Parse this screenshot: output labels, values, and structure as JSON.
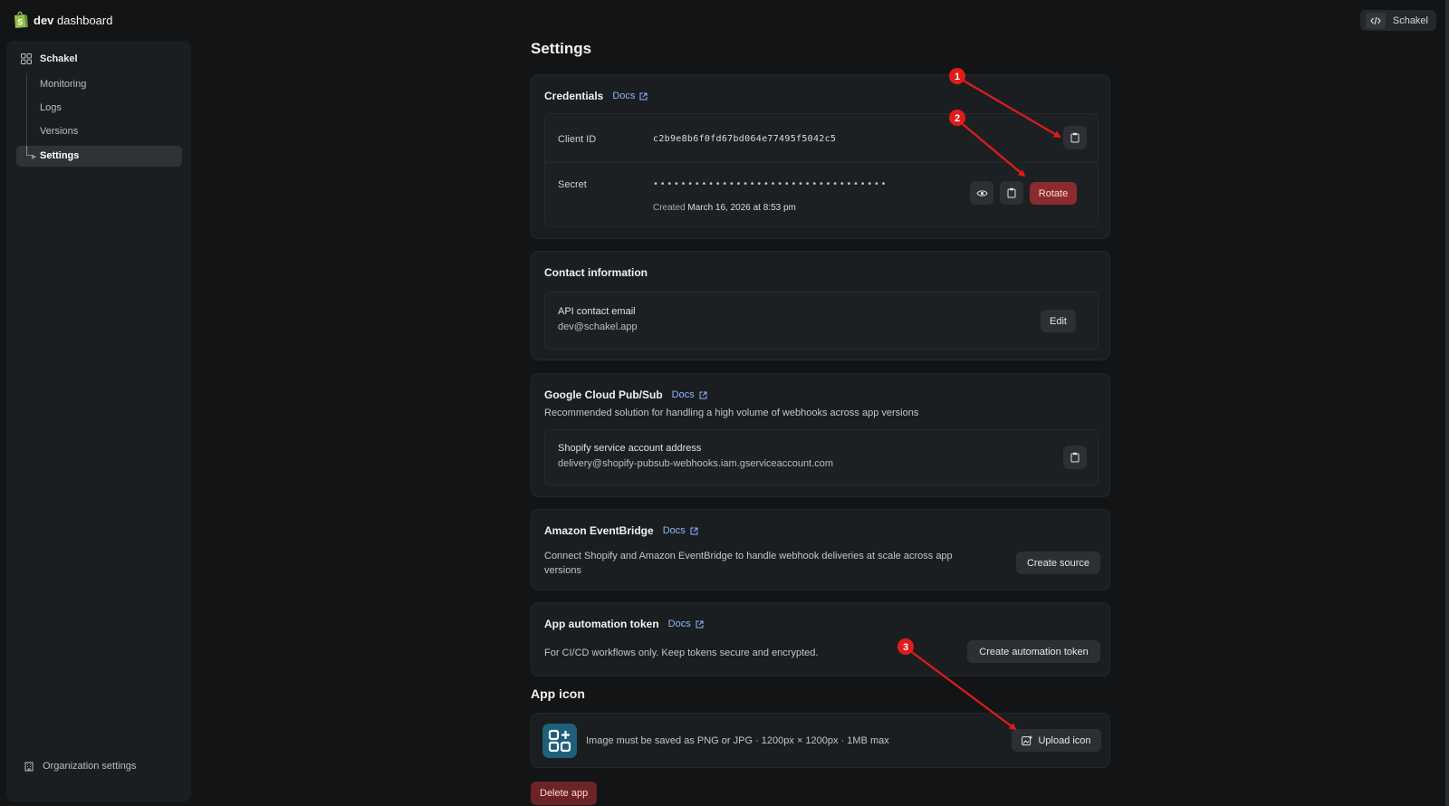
{
  "topbar": {
    "brand_bold": "dev",
    "brand_rest": " dashboard",
    "user_label": "Schakel"
  },
  "sidebar": {
    "app_name": "Schakel",
    "items": [
      {
        "label": "Monitoring"
      },
      {
        "label": "Logs"
      },
      {
        "label": "Versions"
      },
      {
        "label": "Settings"
      }
    ],
    "org_settings": "Organization settings"
  },
  "page": {
    "title": "Settings"
  },
  "credentials": {
    "title": "Credentials",
    "docs": "Docs",
    "client_id_label": "Client ID",
    "client_id_value": "c2b9e8b6f0fd67bd064e77495f5042c5",
    "secret_label": "Secret",
    "secret_value": "••••••••••••••••••••••••••••••••••",
    "created_prefix": "Created",
    "created_date": "March 16, 2026 at 8:53 pm",
    "rotate_label": "Rotate"
  },
  "contact": {
    "title": "Contact information",
    "email_label": "API contact email",
    "email_value": "dev@schakel.app",
    "edit_label": "Edit"
  },
  "pubsub": {
    "title": "Google Cloud Pub/Sub",
    "docs": "Docs",
    "description": "Recommended solution for handling a high volume of webhooks across app versions",
    "account_label": "Shopify service account address",
    "account_value": "delivery@shopify-pubsub-webhooks.iam.gserviceaccount.com"
  },
  "eventbridge": {
    "title": "Amazon EventBridge",
    "docs": "Docs",
    "description": "Connect Shopify and Amazon EventBridge to handle webhook deliveries at scale across app versions",
    "create_label": "Create source"
  },
  "automation": {
    "title": "App automation token",
    "docs": "Docs",
    "description": "For CI/CD workflows only. Keep tokens secure and encrypted.",
    "create_label": "Create automation token"
  },
  "app_icon": {
    "title": "App icon",
    "description": "Image must be saved as PNG or JPG · 1200px × 1200px · 1MB max",
    "upload_label": "Upload icon"
  },
  "delete_label": "Delete app",
  "annotations": [
    {
      "label": "1"
    },
    {
      "label": "2"
    },
    {
      "label": "3"
    }
  ],
  "colors": {
    "background": "#121416",
    "card": "#1b1e21",
    "link": "#8fb3ff",
    "danger": "#8c2b2e",
    "annotation": "#e01b1b",
    "brand_green": "#95bf47"
  }
}
